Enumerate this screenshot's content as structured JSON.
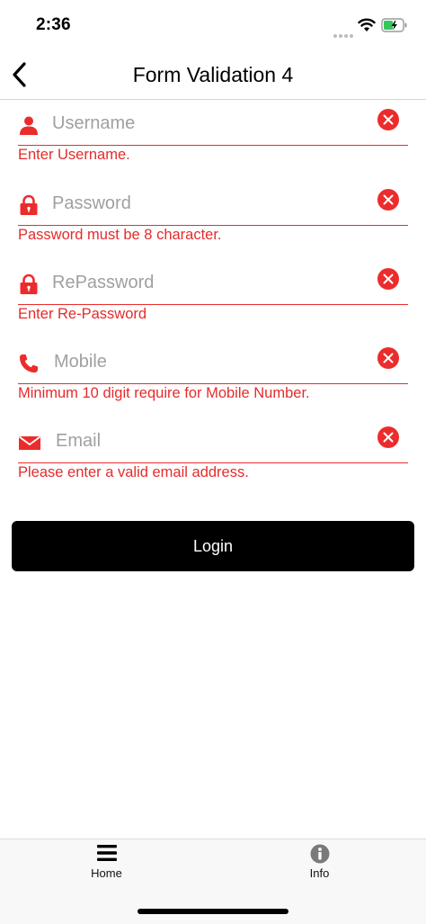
{
  "status_bar": {
    "time": "2:36"
  },
  "nav": {
    "title": "Form Validation 4",
    "back_icon": "chevron-left-icon"
  },
  "form": {
    "fields": [
      {
        "placeholder": "Username",
        "value": "",
        "error": "Enter Username.",
        "icon": "user-icon"
      },
      {
        "placeholder": "Password",
        "value": "",
        "error": "Password must be 8 character.",
        "icon": "lock-icon"
      },
      {
        "placeholder": "RePassword",
        "value": "",
        "error": "Enter Re-Password",
        "icon": "lock-icon"
      },
      {
        "placeholder": "Mobile",
        "value": "",
        "error": "Minimum 10 digit require for Mobile Number.",
        "icon": "phone-icon"
      },
      {
        "placeholder": "Email",
        "value": "",
        "error": "Please enter a valid email address.",
        "icon": "mail-icon"
      }
    ],
    "login_label": "Login"
  },
  "tab_bar": {
    "tabs": [
      {
        "label": "Home",
        "icon": "menu-icon"
      },
      {
        "label": "Info",
        "icon": "info-icon"
      }
    ]
  },
  "colors": {
    "error": "#EC2C2C",
    "button": "#000000",
    "placeholder": "#A0A0A0"
  }
}
